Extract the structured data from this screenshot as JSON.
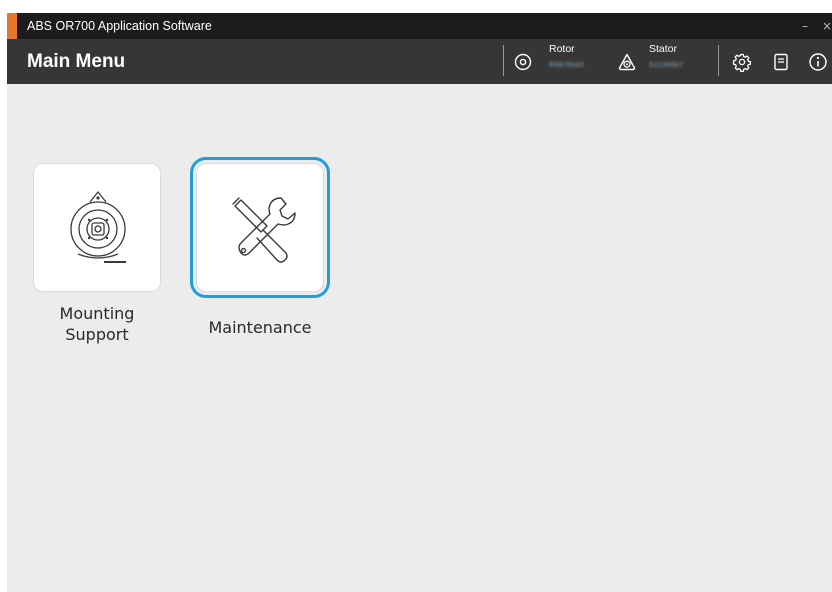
{
  "window": {
    "title": "ABS OR700 Application Software",
    "minimize_glyph": "–",
    "close_glyph": "×",
    "accent_color": "#e8772e"
  },
  "header": {
    "page_title": "Main Menu",
    "rotor": {
      "label": "Rotor",
      "value": "R0876543",
      "icon": "rotor-icon"
    },
    "stator": {
      "label": "Stator",
      "value": "S1234567",
      "icon": "stator-icon"
    },
    "icons": [
      "settings-gear-icon",
      "document-icon",
      "info-icon"
    ]
  },
  "menu": {
    "items": [
      {
        "label": "Mounting Support",
        "icon": "mounting-support-icon",
        "selected": false
      },
      {
        "label": "Maintenance",
        "icon": "wrench-screwdriver-icon",
        "selected": true
      }
    ]
  },
  "colors": {
    "header_bg": "#363636",
    "titlebar_bg": "#1c1c1c",
    "content_bg": "#ececec",
    "selection": "#1e9fd9"
  }
}
